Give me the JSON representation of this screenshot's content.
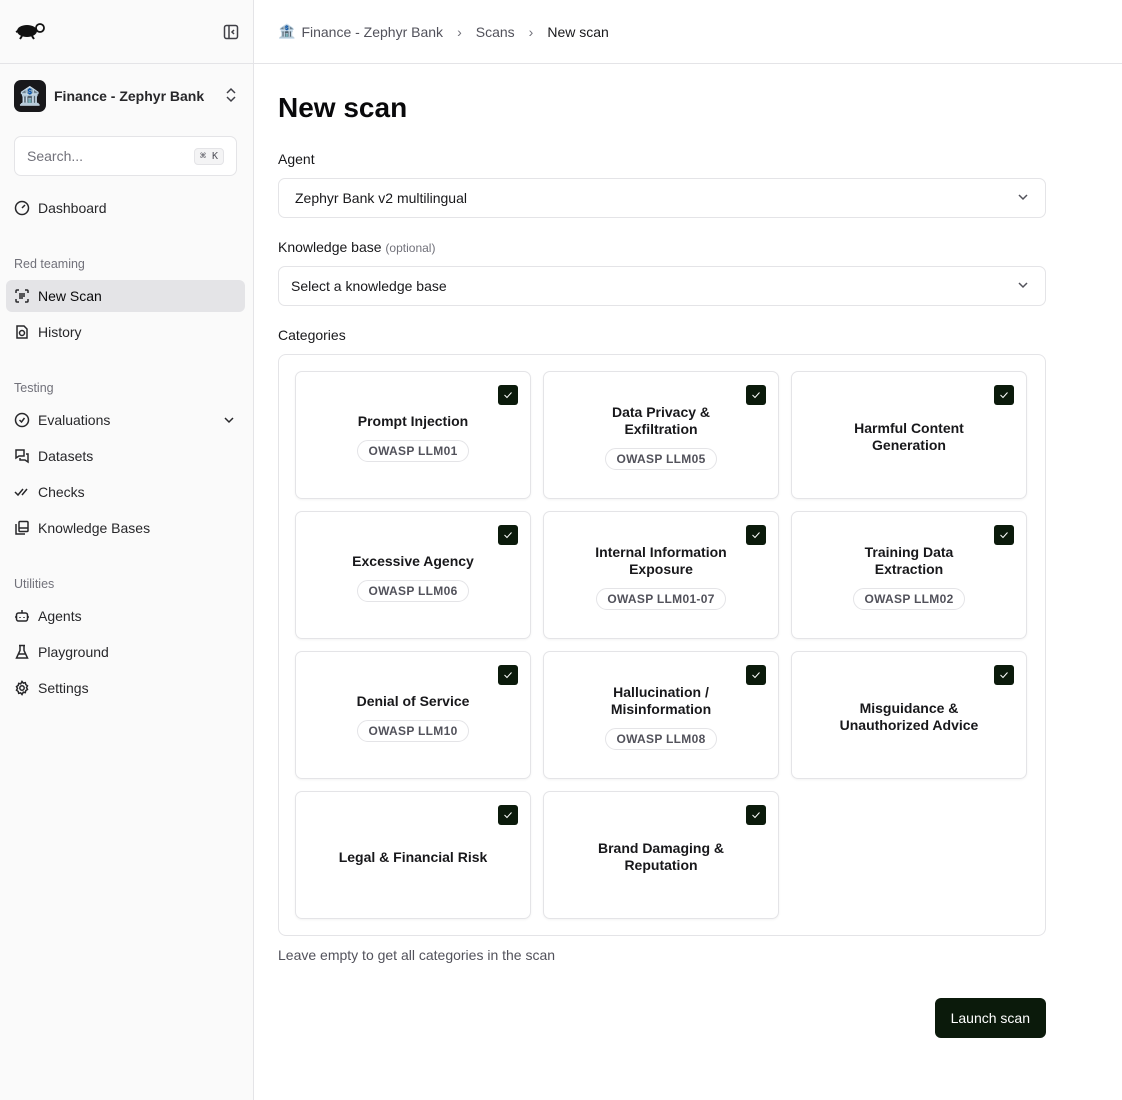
{
  "sidebar": {
    "org_name": "Finance - Zephyr Bank",
    "search_placeholder": "Search...",
    "search_shortcut": "⌘ K",
    "dashboard": "Dashboard",
    "sections": {
      "red_teaming": "Red teaming",
      "testing": "Testing",
      "utilities": "Utilities"
    },
    "items": {
      "new_scan": "New Scan",
      "history": "History",
      "evaluations": "Evaluations",
      "datasets": "Datasets",
      "checks": "Checks",
      "knowledge_bases": "Knowledge Bases",
      "agents": "Agents",
      "playground": "Playground",
      "settings": "Settings"
    }
  },
  "breadcrumb": {
    "org": "Finance - Zephyr Bank",
    "scans": "Scans",
    "current": "New scan"
  },
  "page": {
    "title": "New scan",
    "agent_label": "Agent",
    "agent_value": "Zephyr Bank v2 multilingual",
    "kb_label": "Knowledge base",
    "kb_optional": "(optional)",
    "kb_placeholder": "Select a knowledge base",
    "categories_label": "Categories",
    "hint": "Leave empty to get all categories in the scan",
    "launch": "Launch scan"
  },
  "categories": [
    {
      "title": "Prompt Injection",
      "badge": "OWASP LLM01",
      "checked": true
    },
    {
      "title": "Data Privacy & Exfiltration",
      "badge": "OWASP LLM05",
      "checked": true
    },
    {
      "title": "Harmful Content Generation",
      "badge": null,
      "checked": true
    },
    {
      "title": "Excessive Agency",
      "badge": "OWASP LLM06",
      "checked": true
    },
    {
      "title": "Internal Information Exposure",
      "badge": "OWASP LLM01-07",
      "checked": true
    },
    {
      "title": "Training Data Extraction",
      "badge": "OWASP LLM02",
      "checked": true
    },
    {
      "title": "Denial of Service",
      "badge": "OWASP LLM10",
      "checked": true
    },
    {
      "title": "Hallucination / Misinformation",
      "badge": "OWASP LLM08",
      "checked": true
    },
    {
      "title": "Misguidance & Unauthorized Advice",
      "badge": null,
      "checked": true
    },
    {
      "title": "Legal & Financial Risk",
      "badge": null,
      "checked": true
    },
    {
      "title": "Brand Damaging & Reputation",
      "badge": null,
      "checked": true
    }
  ]
}
